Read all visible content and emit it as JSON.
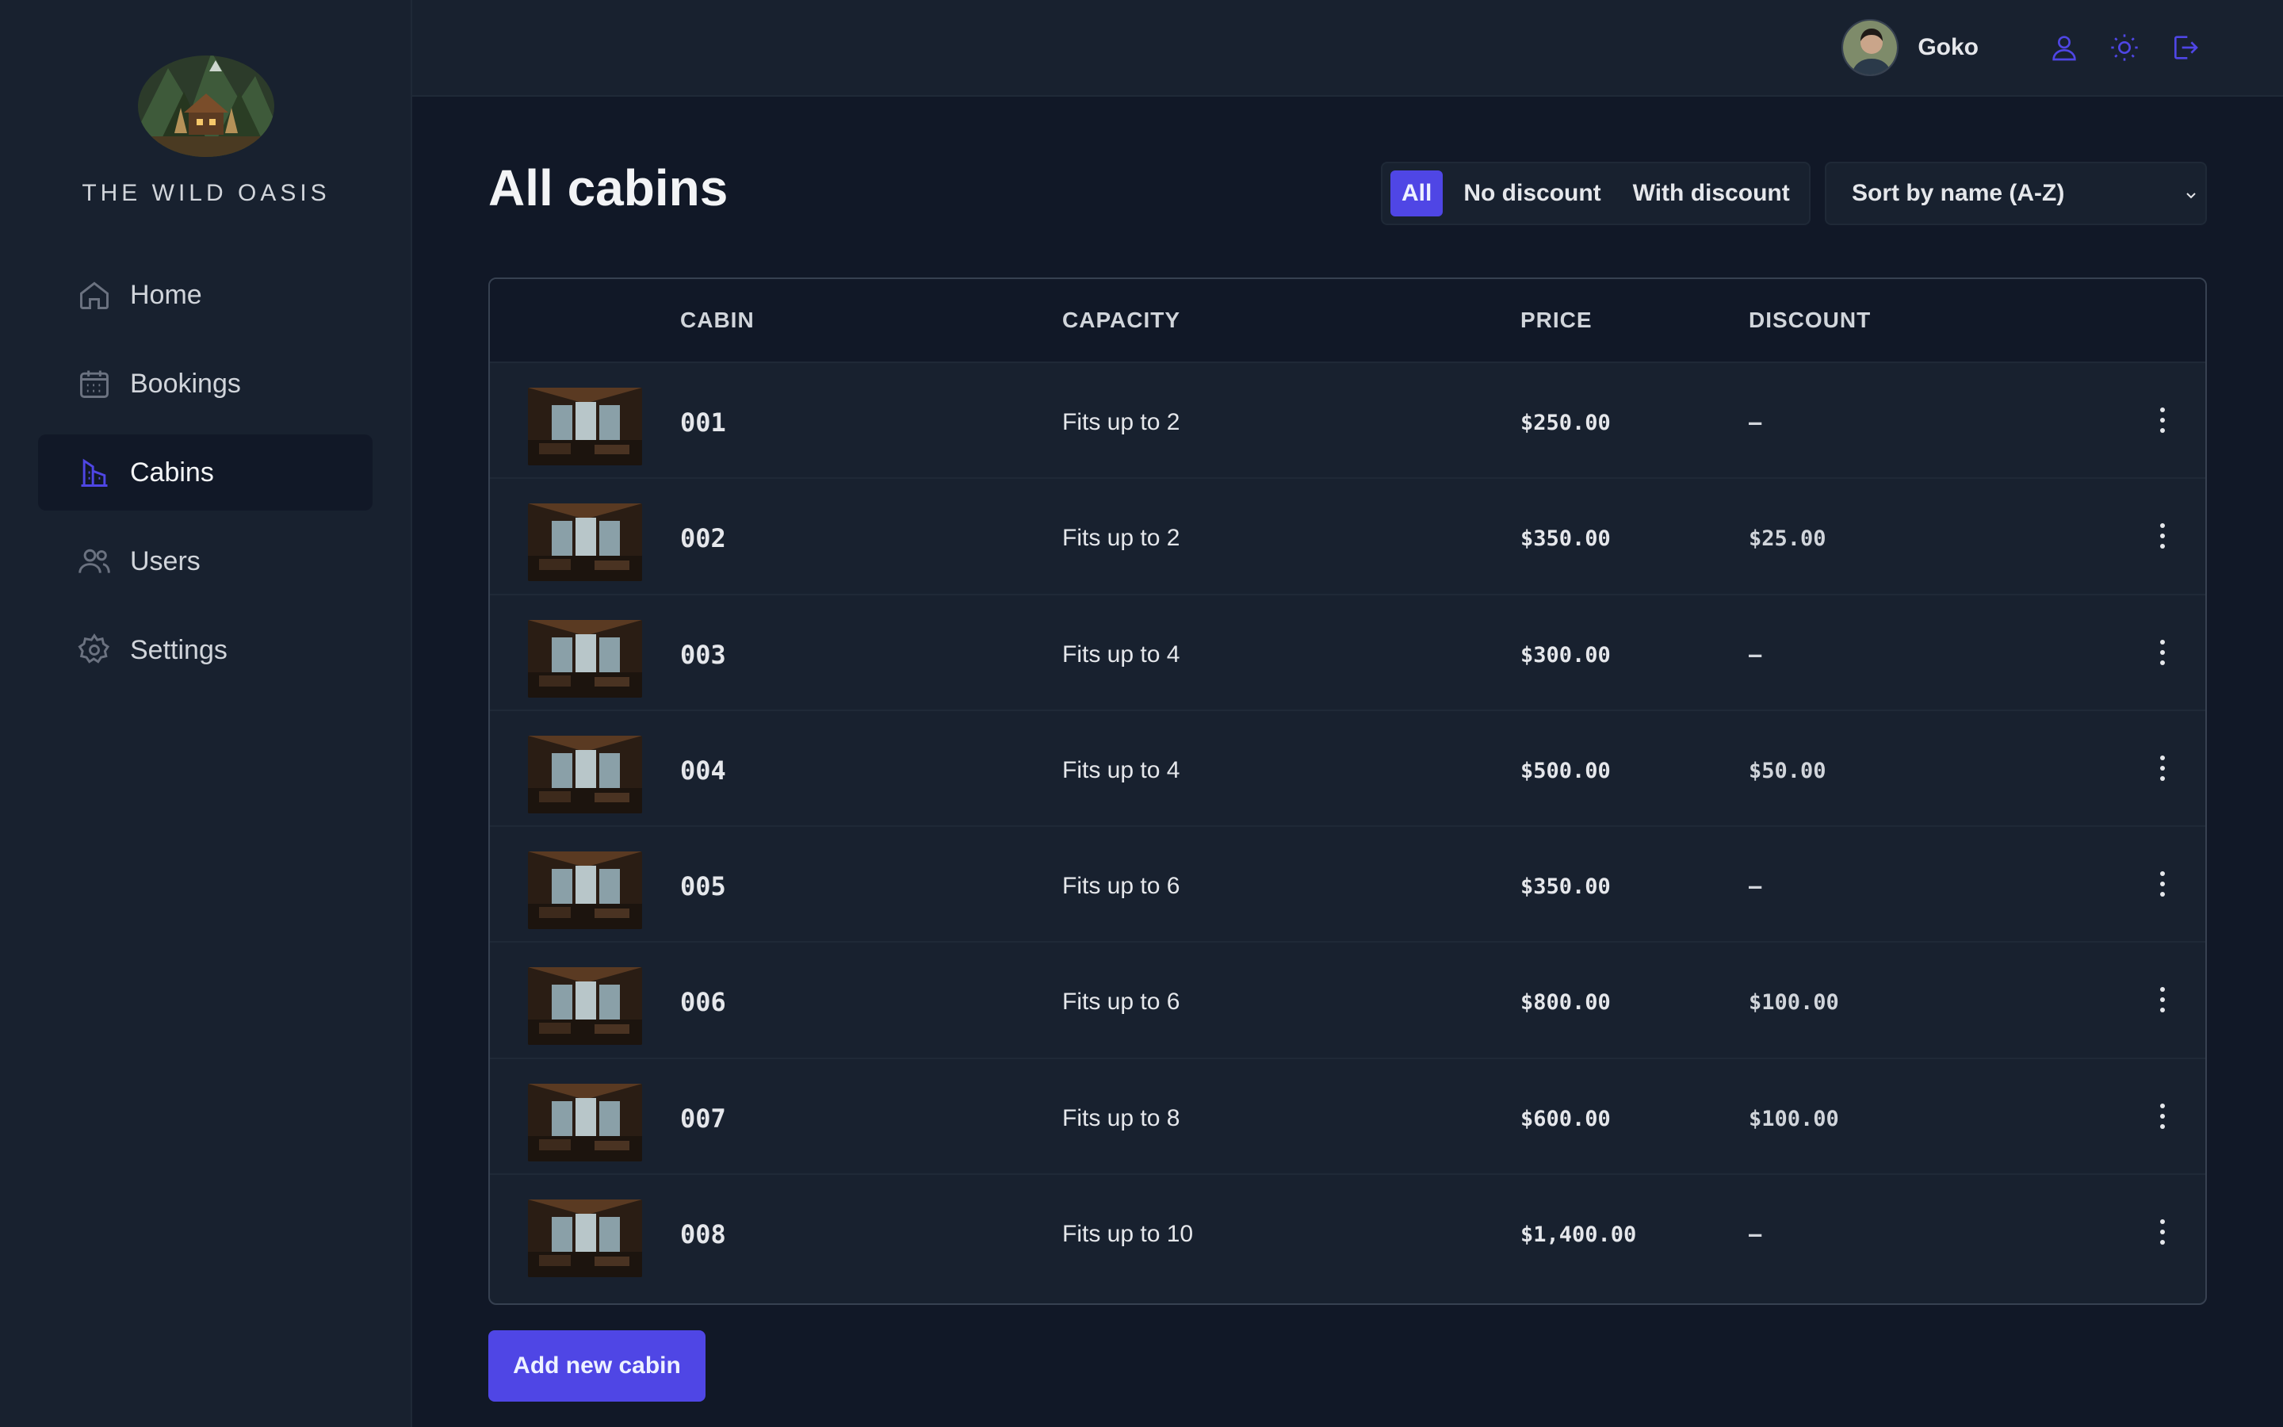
{
  "brand": {
    "name": "THE WILD OASIS"
  },
  "nav": {
    "items": [
      {
        "label": "Home",
        "icon": "home-icon"
      },
      {
        "label": "Bookings",
        "icon": "calendar-icon"
      },
      {
        "label": "Cabins",
        "icon": "building-icon",
        "active": true
      },
      {
        "label": "Users",
        "icon": "users-icon"
      },
      {
        "label": "Settings",
        "icon": "gear-icon"
      }
    ]
  },
  "header": {
    "user_name": "Goko",
    "buttons": [
      "user-icon",
      "sun-icon",
      "logout-icon"
    ]
  },
  "page": {
    "title": "All cabins",
    "filter": {
      "options": [
        "All",
        "No discount",
        "With discount"
      ],
      "selected": "All"
    },
    "sort": {
      "selected": "Sort by name (A-Z)"
    }
  },
  "table": {
    "columns": [
      "",
      "CABIN",
      "CAPACITY",
      "PRICE",
      "DISCOUNT"
    ],
    "rows": [
      {
        "name": "001",
        "capacity": "Fits up to 2",
        "price": "$250.00",
        "discount": "—"
      },
      {
        "name": "002",
        "capacity": "Fits up to 2",
        "price": "$350.00",
        "discount": "$25.00"
      },
      {
        "name": "003",
        "capacity": "Fits up to 4",
        "price": "$300.00",
        "discount": "—"
      },
      {
        "name": "004",
        "capacity": "Fits up to 4",
        "price": "$500.00",
        "discount": "$50.00"
      },
      {
        "name": "005",
        "capacity": "Fits up to 6",
        "price": "$350.00",
        "discount": "—"
      },
      {
        "name": "006",
        "capacity": "Fits up to 6",
        "price": "$800.00",
        "discount": "$100.00"
      },
      {
        "name": "007",
        "capacity": "Fits up to 8",
        "price": "$600.00",
        "discount": "$100.00"
      },
      {
        "name": "008",
        "capacity": "Fits up to 10",
        "price": "$1,400.00",
        "discount": "—"
      }
    ]
  },
  "actions": {
    "add_cabin": "Add new cabin"
  },
  "colors": {
    "accent": "#4f46e5",
    "bg": "#111827",
    "panel": "#18212f"
  }
}
